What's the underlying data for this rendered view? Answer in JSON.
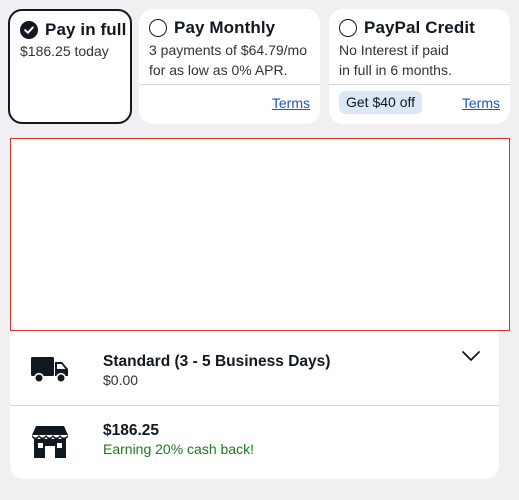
{
  "payment_options": {
    "full": {
      "title": "Pay in full",
      "subtitle": "$186.25 today",
      "selected": true
    },
    "monthly": {
      "title": "Pay Monthly",
      "subtitle_line1": "3 payments of $64.79/mo",
      "subtitle_line2": "for as low as 0% APR.",
      "terms_label": "Terms"
    },
    "paypal_credit": {
      "title": "PayPal Credit",
      "subtitle_line1": "No Interest if paid",
      "subtitle_line2": "in full in 6 months.",
      "badge_label": "Get $40 off",
      "terms_label": "Terms"
    }
  },
  "shipping": {
    "standard": {
      "icon": "truck-icon",
      "title": "Standard (3 - 5 Business Days)",
      "price": "$0.00"
    },
    "store": {
      "icon": "store-icon",
      "price": "$186.25",
      "cashback": "Earning 20% cash back!"
    }
  },
  "colors": {
    "accent_link": "#1a56c8",
    "badge_bg": "#dce8f7",
    "cashback_green": "#1b7a1b",
    "frame_border": "#d9322b"
  }
}
